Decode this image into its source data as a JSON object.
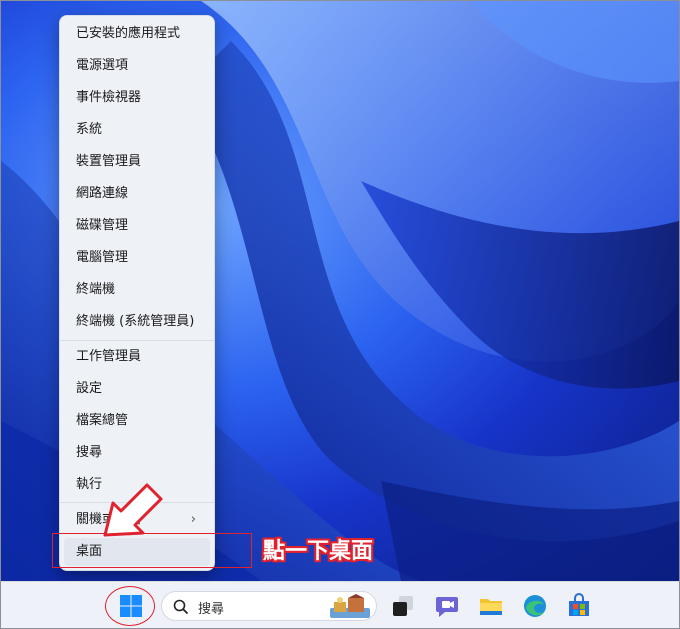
{
  "context_menu": {
    "items": [
      {
        "label": "已安裝的應用程式"
      },
      {
        "label": "電源選項"
      },
      {
        "label": "事件檢視器"
      },
      {
        "label": "系統"
      },
      {
        "label": "裝置管理員"
      },
      {
        "label": "網路連線"
      },
      {
        "label": "磁碟管理"
      },
      {
        "label": "電腦管理"
      },
      {
        "label": "終端機"
      },
      {
        "label": "終端機 (系統管理員)"
      },
      {
        "label": "工作管理員"
      },
      {
        "label": "設定"
      },
      {
        "label": "檔案總管"
      },
      {
        "label": "搜尋"
      },
      {
        "label": "執行"
      },
      {
        "label": "關機或登出"
      },
      {
        "label": "桌面"
      }
    ]
  },
  "annotation": {
    "text": "點一下桌面"
  },
  "taskbar": {
    "search_label": "搜尋",
    "icons": [
      "windows-start-icon",
      "search-icon",
      "task-view-icon",
      "teams-chat-icon",
      "file-explorer-icon",
      "edge-browser-icon",
      "microsoft-store-icon"
    ]
  },
  "colors": {
    "annotation_red": "#e0222e",
    "wallpaper_blue": "#1f4fe8",
    "menu_bg": "#eef1f6"
  }
}
